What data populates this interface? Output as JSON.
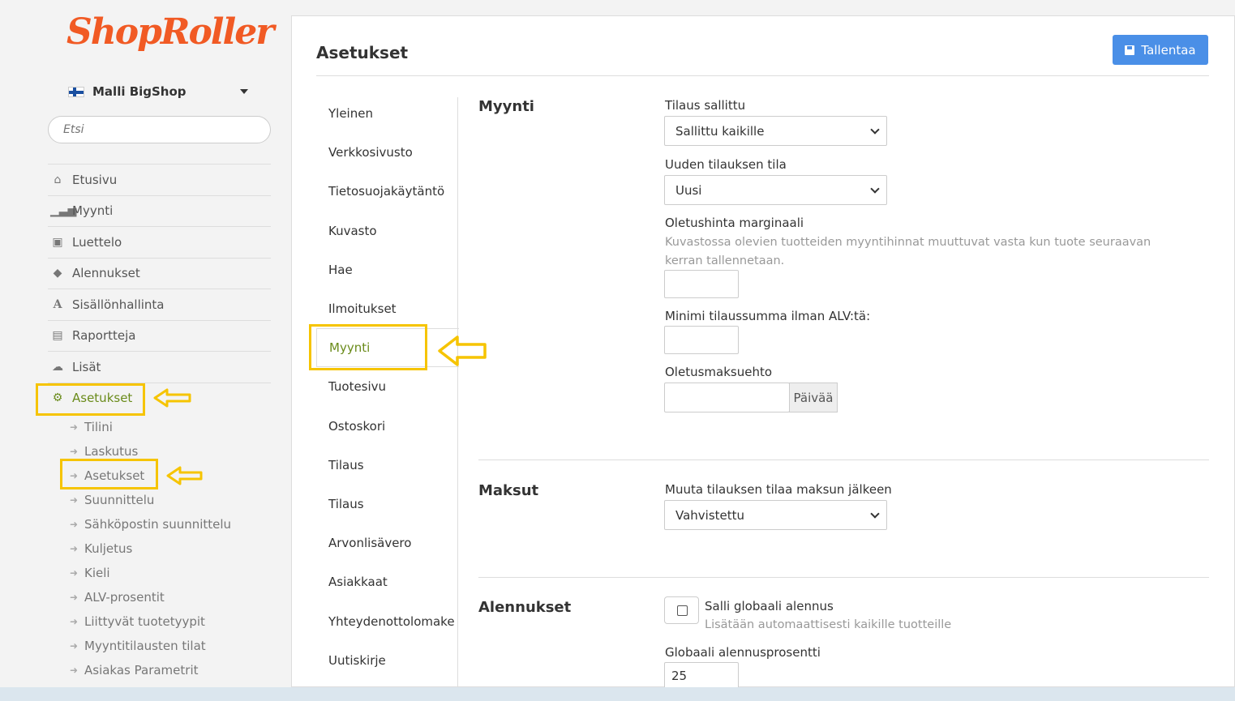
{
  "brand": {
    "logo_text": "ShopRoller",
    "accent": "#f15a24"
  },
  "store": {
    "name": "Malli BigShop"
  },
  "search": {
    "placeholder": "Etsi"
  },
  "nav": [
    {
      "label": "Etusivu",
      "icon": "home-icon"
    },
    {
      "label": "Myynti",
      "icon": "bar-chart-icon"
    },
    {
      "label": "Luettelo",
      "icon": "image-icon"
    },
    {
      "label": "Alennukset",
      "icon": "tags-icon"
    },
    {
      "label": "Sisällönhallinta",
      "icon": "font-icon"
    },
    {
      "label": "Raportteja",
      "icon": "chart-icon"
    },
    {
      "label": "Lisät",
      "icon": "cloud-icon"
    },
    {
      "label": "Asetukset",
      "icon": "gear-icon"
    }
  ],
  "subnav": [
    "Tilini",
    "Laskutus",
    "Asetukset",
    "Suunnittelu",
    "Sähköpostin suunnittelu",
    "Kuljetus",
    "Kieli",
    "ALV-prosentit",
    "Liittyvät tuotetyypit",
    "Myyntitilausten tilat",
    "Asiakas Parametrit"
  ],
  "page": {
    "title": "Asetukset",
    "save_label": "Tallentaa"
  },
  "tabs": [
    "Yleinen",
    "Verkkosivusto",
    "Tietosuojakäytäntö",
    "Kuvasto",
    "Hae",
    "Ilmoitukset",
    "Myynti",
    "Tuotesivu",
    "Ostoskori",
    "Tilaus",
    "Tilaus",
    "Arvonlisävero",
    "Asiakkaat",
    "Yhteydenottolomake",
    "Uutiskirje"
  ],
  "sales": {
    "title": "Myynti",
    "order_allowed_label": "Tilaus sallittu",
    "order_allowed_value": "Sallittu kaikille",
    "new_order_status_label": "Uuden tilauksen tila",
    "new_order_status_value": "Uusi",
    "margin_label": "Oletushinta marginaali",
    "margin_hint": "Kuvastossa olevien tuotteiden myyntihinnat muuttuvat vasta kun tuote seuraavan kerran tallennetaan.",
    "margin_value": "",
    "min_sum_label": "Minimi tilaussumma ilman ALV:tä:",
    "min_sum_value": "",
    "payment_term_label": "Oletusmaksuehto",
    "payment_term_value": "",
    "payment_term_unit": "Päivää"
  },
  "payments": {
    "title": "Maksut",
    "status_label": "Muuta tilauksen tilaa maksun jälkeen",
    "status_value": "Vahvistettu"
  },
  "discounts": {
    "title": "Alennukset",
    "global_label": "Salli globaali alennus",
    "global_hint": "Lisätään automaattisesti kaikille tuotteille",
    "percent_label": "Globaali alennusprosentti",
    "percent_value": "25"
  },
  "colors": {
    "highlight": "#f6c400",
    "active_green": "#6a8b1a",
    "button_blue": "#4a8fe7"
  }
}
